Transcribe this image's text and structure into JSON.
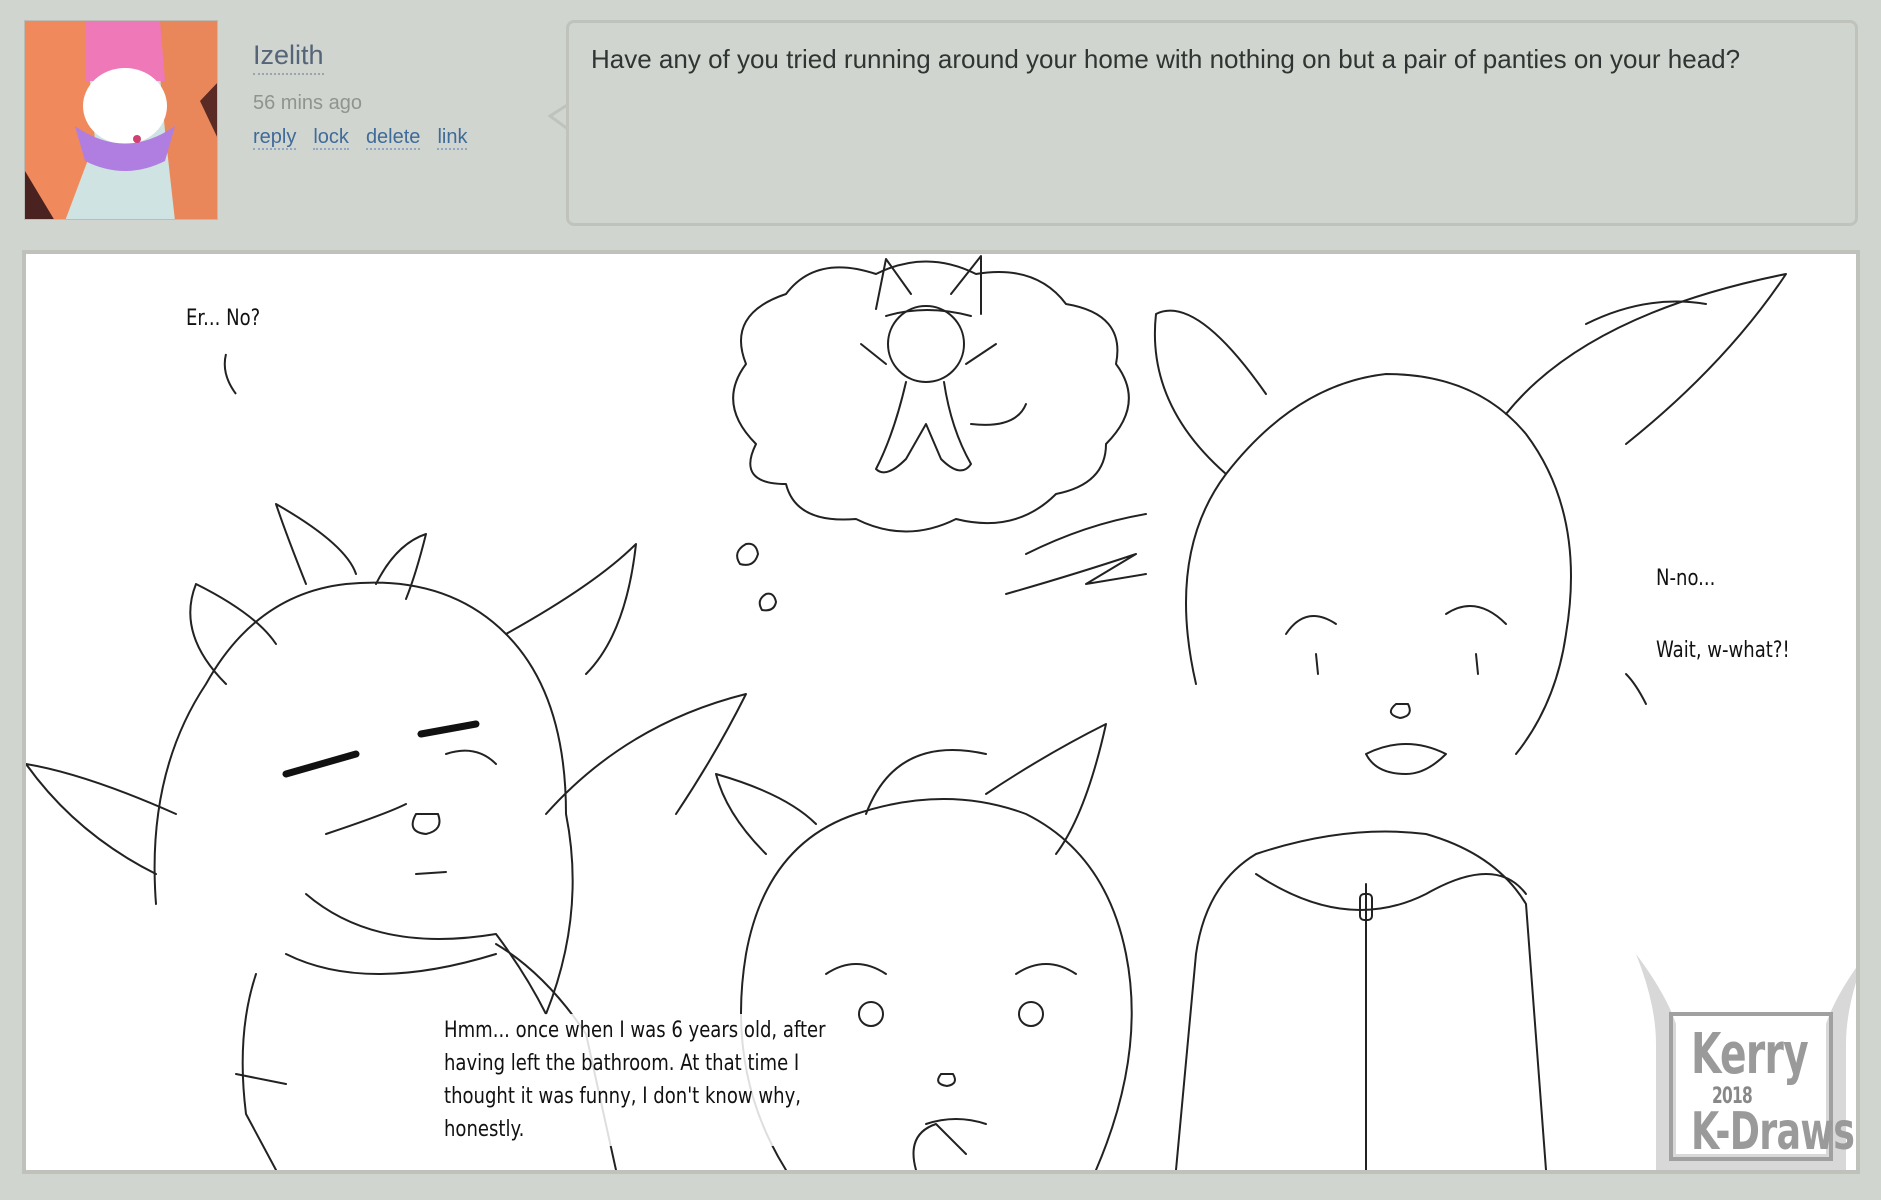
{
  "comment": {
    "username": "Izelith",
    "timestamp": "56 mins ago",
    "actions": [
      "reply",
      "lock",
      "delete",
      "link"
    ],
    "message": "Have any of you tried running around your home with nothing on but a pair of panties on your head?"
  },
  "comic": {
    "bubble_left": "Er... No?",
    "bubble_right_1": "N-no...",
    "bubble_right_2": "Wait, w-what?!",
    "bubble_bottom_lines": [
      "Hmm... once when I was 6 years old, after",
      "having left the bathroom. At that time I",
      "thought it was funny, I don't know why,",
      "honestly."
    ],
    "watermark": {
      "line1": "Kerry",
      "year": "2018",
      "line2": "K-Draws"
    }
  },
  "colors": {
    "page_bg": "#d1d5cf",
    "link": "#3e6b9a",
    "username": "#556478"
  }
}
